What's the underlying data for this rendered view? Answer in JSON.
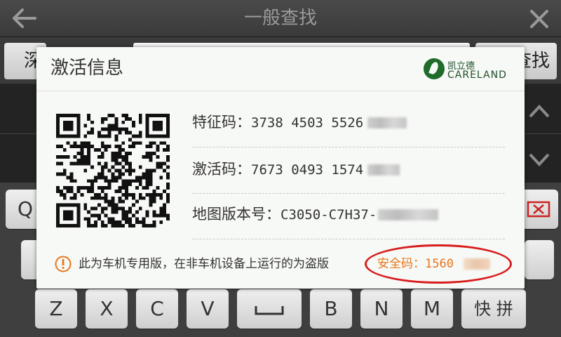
{
  "topbar": {
    "title": "一般查找"
  },
  "search": {
    "city": "深",
    "button": "查找"
  },
  "keyboard": {
    "row2_left": "Q",
    "row4": [
      "Z",
      "X",
      "C",
      "V",
      "B",
      "N",
      "M"
    ],
    "mode": "快 拼"
  },
  "dialog": {
    "title": "激活信息",
    "logo": {
      "cn": "凯立德",
      "en": "CARELAND"
    },
    "feature": {
      "label": "特征码：",
      "value": "3738 4503 5526"
    },
    "activation": {
      "label": "激活码：",
      "value": "7673 0493 1574"
    },
    "map_version": {
      "label": "地图版本号：",
      "value": "C3050-C7H37-"
    },
    "notice": "此为车机专用版，在非车机设备上运行的为盗版",
    "safe_code": {
      "label": "安全码：",
      "value": "1560"
    }
  },
  "colors": {
    "accent_orange": "#e8761c",
    "highlight_red": "#d81e1e"
  }
}
